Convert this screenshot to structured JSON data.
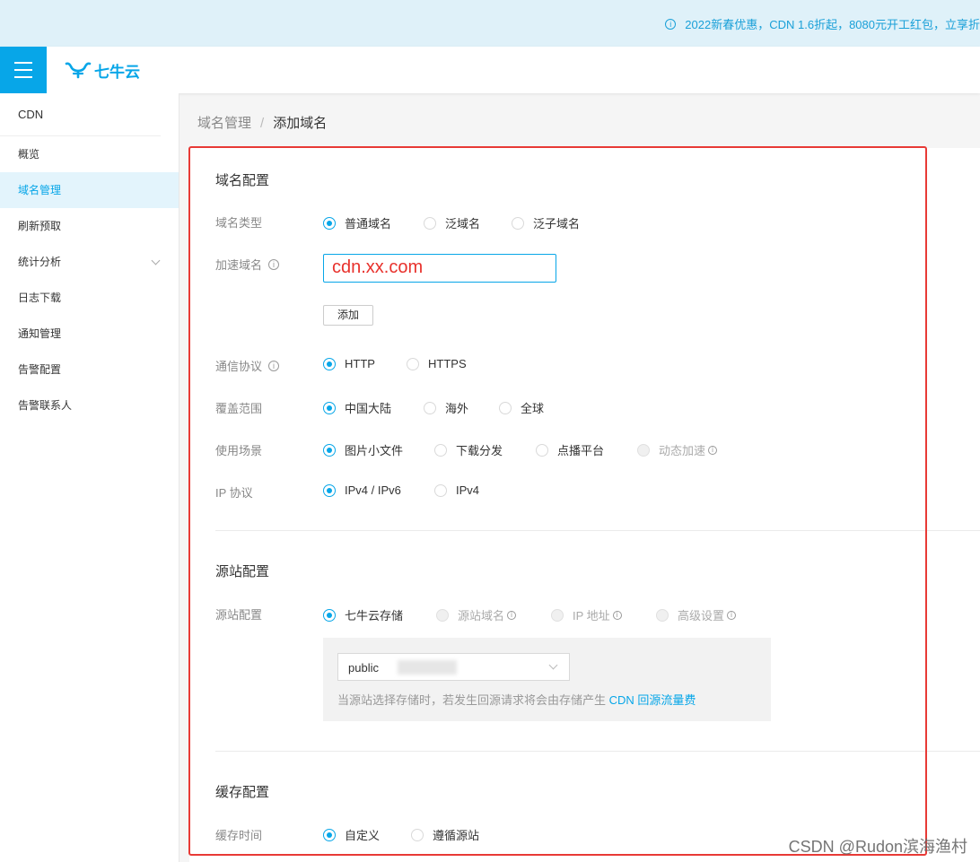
{
  "banner": {
    "text": "2022新春优惠，CDN 1.6折起，8080元开工红包，立享折"
  },
  "header": {
    "logo_text": "七牛云"
  },
  "sidebar": {
    "section": "CDN",
    "items": [
      {
        "label": "概览"
      },
      {
        "label": "域名管理",
        "active": true
      },
      {
        "label": "刷新预取"
      },
      {
        "label": "统计分析",
        "expandable": true
      },
      {
        "label": "日志下载"
      },
      {
        "label": "通知管理"
      },
      {
        "label": "告警配置"
      },
      {
        "label": "告警联系人"
      }
    ]
  },
  "breadcrumb": {
    "parent": "域名管理",
    "separator": "/",
    "current": "添加域名"
  },
  "domain_config": {
    "title": "域名配置",
    "type": {
      "label": "域名类型",
      "options": [
        "普通域名",
        "泛域名",
        "泛子域名"
      ],
      "selected": "普通域名"
    },
    "accel": {
      "label": "加速域名",
      "value": "cdn.xx.com",
      "add_button": "添加"
    },
    "protocol": {
      "label": "通信协议",
      "options": [
        "HTTP",
        "HTTPS"
      ],
      "selected": "HTTP"
    },
    "coverage": {
      "label": "覆盖范围",
      "options": [
        "中国大陆",
        "海外",
        "全球"
      ],
      "selected": "中国大陆"
    },
    "scenario": {
      "label": "使用场景",
      "options": [
        "图片小文件",
        "下载分发",
        "点播平台",
        "动态加速"
      ],
      "selected": "图片小文件",
      "disabled": [
        "动态加速"
      ]
    },
    "ip_protocol": {
      "label": "IP 协议",
      "options": [
        "IPv4 / IPv6",
        "IPv4"
      ],
      "selected": "IPv4 / IPv6"
    }
  },
  "source_config": {
    "title": "源站配置",
    "label": "源站配置",
    "options": [
      "七牛云存储",
      "源站域名",
      "IP 地址",
      "高级设置"
    ],
    "selected": "七牛云存储",
    "disabled": [
      "源站域名",
      "IP 地址",
      "高级设置"
    ],
    "bucket_value": "public",
    "note_prefix": "当源站选择存储时，若发生回源请求将会由存储产生",
    "note_link": "CDN 回源流量费"
  },
  "cache_config": {
    "title": "缓存配置",
    "label": "缓存时间",
    "options": [
      "自定义",
      "遵循源站"
    ],
    "selected": "自定义"
  },
  "watermark": "CSDN @Rudon滨海渔村",
  "colors": {
    "accent": "#07a6e8",
    "highlight_border": "#e83a36",
    "input_text": "#e8312c"
  }
}
